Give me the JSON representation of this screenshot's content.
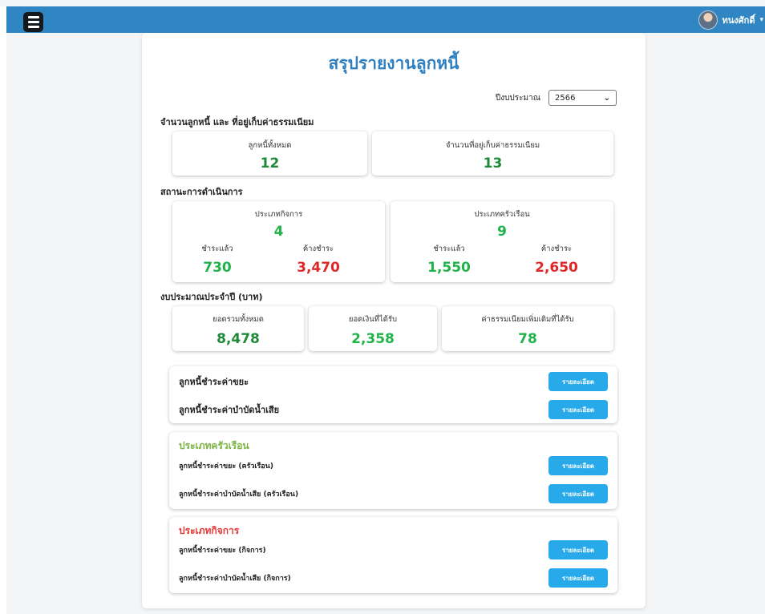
{
  "topbar": {
    "user_name": "ทนงศักดิ์",
    "accent": "#2f86c3",
    "menu_icon": "hamburger-icon"
  },
  "page": {
    "title": "สรุปรายงานลูกหนี้"
  },
  "year_filter": {
    "label": "ปีงบประมาณ",
    "value": "2566"
  },
  "debtors": {
    "title": "จำนวนลูกหนี้ และ ที่อยู่เก็บค่าธรรมเนียม",
    "total_label": "ลูกหนี้ทั้งหมด",
    "total_value": "12",
    "addr_label": "จำนวนที่อยู่เก็บค่าธรรมเนียม",
    "addr_value": "13"
  },
  "status": {
    "title": "สถานะการดำเนินการ",
    "business": {
      "label": "ประเภทกิจการ",
      "value": "4",
      "paid_label": "ชำระแล้ว",
      "paid": "730",
      "due_label": "ค้างชำระ",
      "due": "3,470"
    },
    "household": {
      "label": "ประเภทครัวเรือน",
      "value": "9",
      "paid_label": "ชำระแล้ว",
      "paid": "1,550",
      "due_label": "ค้างชำระ",
      "due": "2,650"
    }
  },
  "budget": {
    "title": "งบประมาณประจำปี (บาท)",
    "total_label": "ยอดรวมทั้งหมด",
    "total": "8,478",
    "received_label": "ยอดเงินที่ได้รับ",
    "received": "2,358",
    "extra_label": "ค่าธรรมเนียมเพิ่มเติมที่ได้รับ",
    "extra": "78"
  },
  "general": {
    "items": [
      {
        "label": "ลูกหนี้ชำระค่าขยะ",
        "button": "รายละเอียด"
      },
      {
        "label": "ลูกหนี้ชำระค่าบำบัดน้ำเสีย",
        "button": "รายละเอียด"
      }
    ]
  },
  "household_list": {
    "title": "ประเภทครัวเรือน",
    "title_color": "#7cb342",
    "items": [
      {
        "label": "ลูกหนี้ชำระค่าขยะ (ครัวเรือน)",
        "button": "รายละเอียด"
      },
      {
        "label": "ลูกหนี้ชำระค่าบำบัดน้ำเสีย (ครัวเรือน)",
        "button": "รายละเอียด"
      }
    ]
  },
  "business_list": {
    "title": "ประเภทกิจการ",
    "title_color": "#e53935",
    "items": [
      {
        "label": "ลูกหนี้ชำระค่าขยะ (กิจการ)",
        "button": "รายละเอียด"
      },
      {
        "label": "ลูกหนี้ชำระค่าบำบัดน้ำเสีย (กิจการ)",
        "button": "รายละเอียด"
      }
    ]
  },
  "colors": {
    "number_green": "#1d8a38",
    "number_bright_green": "#20b34a",
    "number_red": "#de2828",
    "button_blue": "#27a9ea",
    "title_blue": "#2f7fc1"
  }
}
